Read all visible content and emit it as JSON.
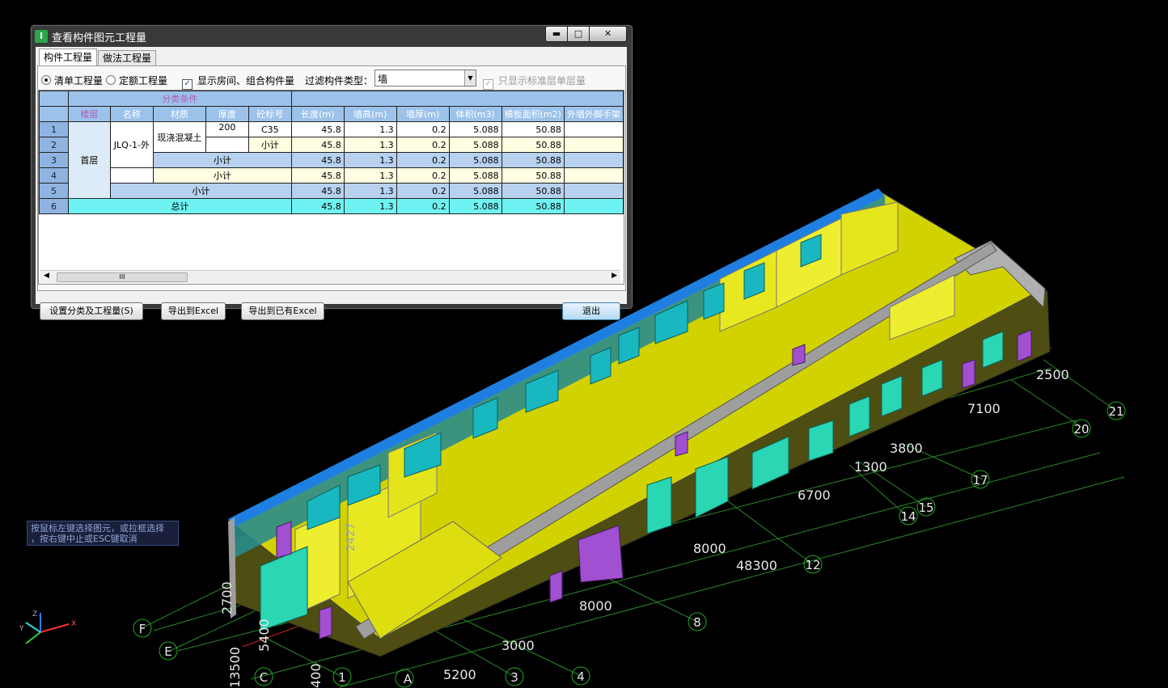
{
  "dialog": {
    "title": "查看构件图元工程量",
    "window_buttons": {
      "minimize": "▬",
      "maximize": "□",
      "close": "✕"
    },
    "tabs": [
      "构件工程量",
      "做法工程量"
    ],
    "options": {
      "radio_list": "清单工程量",
      "radio_quota": "定额工程量",
      "check_rooms": "显示房间、组合构件量",
      "filter_label": "过滤构件类型：",
      "filter_value": "墙",
      "check_std_floor": "只显示标准层单层量"
    },
    "table": {
      "group_header": "分类条件",
      "columns": [
        "楼层",
        "名称",
        "材质",
        "厚度",
        "砼标号",
        "长度(m)",
        "墙高(m)",
        "墙厚(m)",
        "体积(m3)",
        "模板面积(m2)",
        "外墙外脚手架"
      ],
      "row_numbers": [
        "1",
        "2",
        "3",
        "4",
        "5",
        "6"
      ],
      "floor": "首层",
      "name": "JLQ-1-外",
      "material": "现浇混凝土",
      "thickness": "200",
      "grade": "C35",
      "subtotal": "小计",
      "total": "总计",
      "values": [
        "45.8",
        "1.3",
        "0.2",
        "5.088",
        "50.88"
      ]
    },
    "scroll_thumb": "III",
    "buttons": {
      "settings": "设置分类及工程量(S)",
      "export_excel": "导出到Excel",
      "export_existing": "导出到已有Excel",
      "exit": "退出"
    }
  },
  "status_hint": [
    "按鼠标左键选择图元，或拉框选择",
    "，按右键中止或ESC键取消"
  ],
  "model_view": {
    "dimensions": [
      "2500",
      "7100",
      "3800",
      "1300",
      "6700",
      "8000",
      "48300",
      "8000",
      "3000",
      "5200",
      "2700",
      "5400",
      "13500",
      "400",
      "2427"
    ],
    "axis_labels": [
      "21",
      "20",
      "17",
      "15",
      "14",
      "12",
      "8",
      "4",
      "3",
      "1",
      "A",
      "C",
      "E",
      "F"
    ],
    "axes": {
      "x": "X",
      "y": "Y",
      "z": "Z"
    },
    "colors": {
      "wall_top": "#d6d600",
      "wall_side": "#8a8a00",
      "outer_wall": "#5a5a10",
      "parapet": "#a8a8a8",
      "roof_edge": "#1f7fe0",
      "window": "#18c9a8",
      "door": "#a050d0",
      "grid": "#33a833",
      "axis_circle": "#22aa22"
    }
  }
}
